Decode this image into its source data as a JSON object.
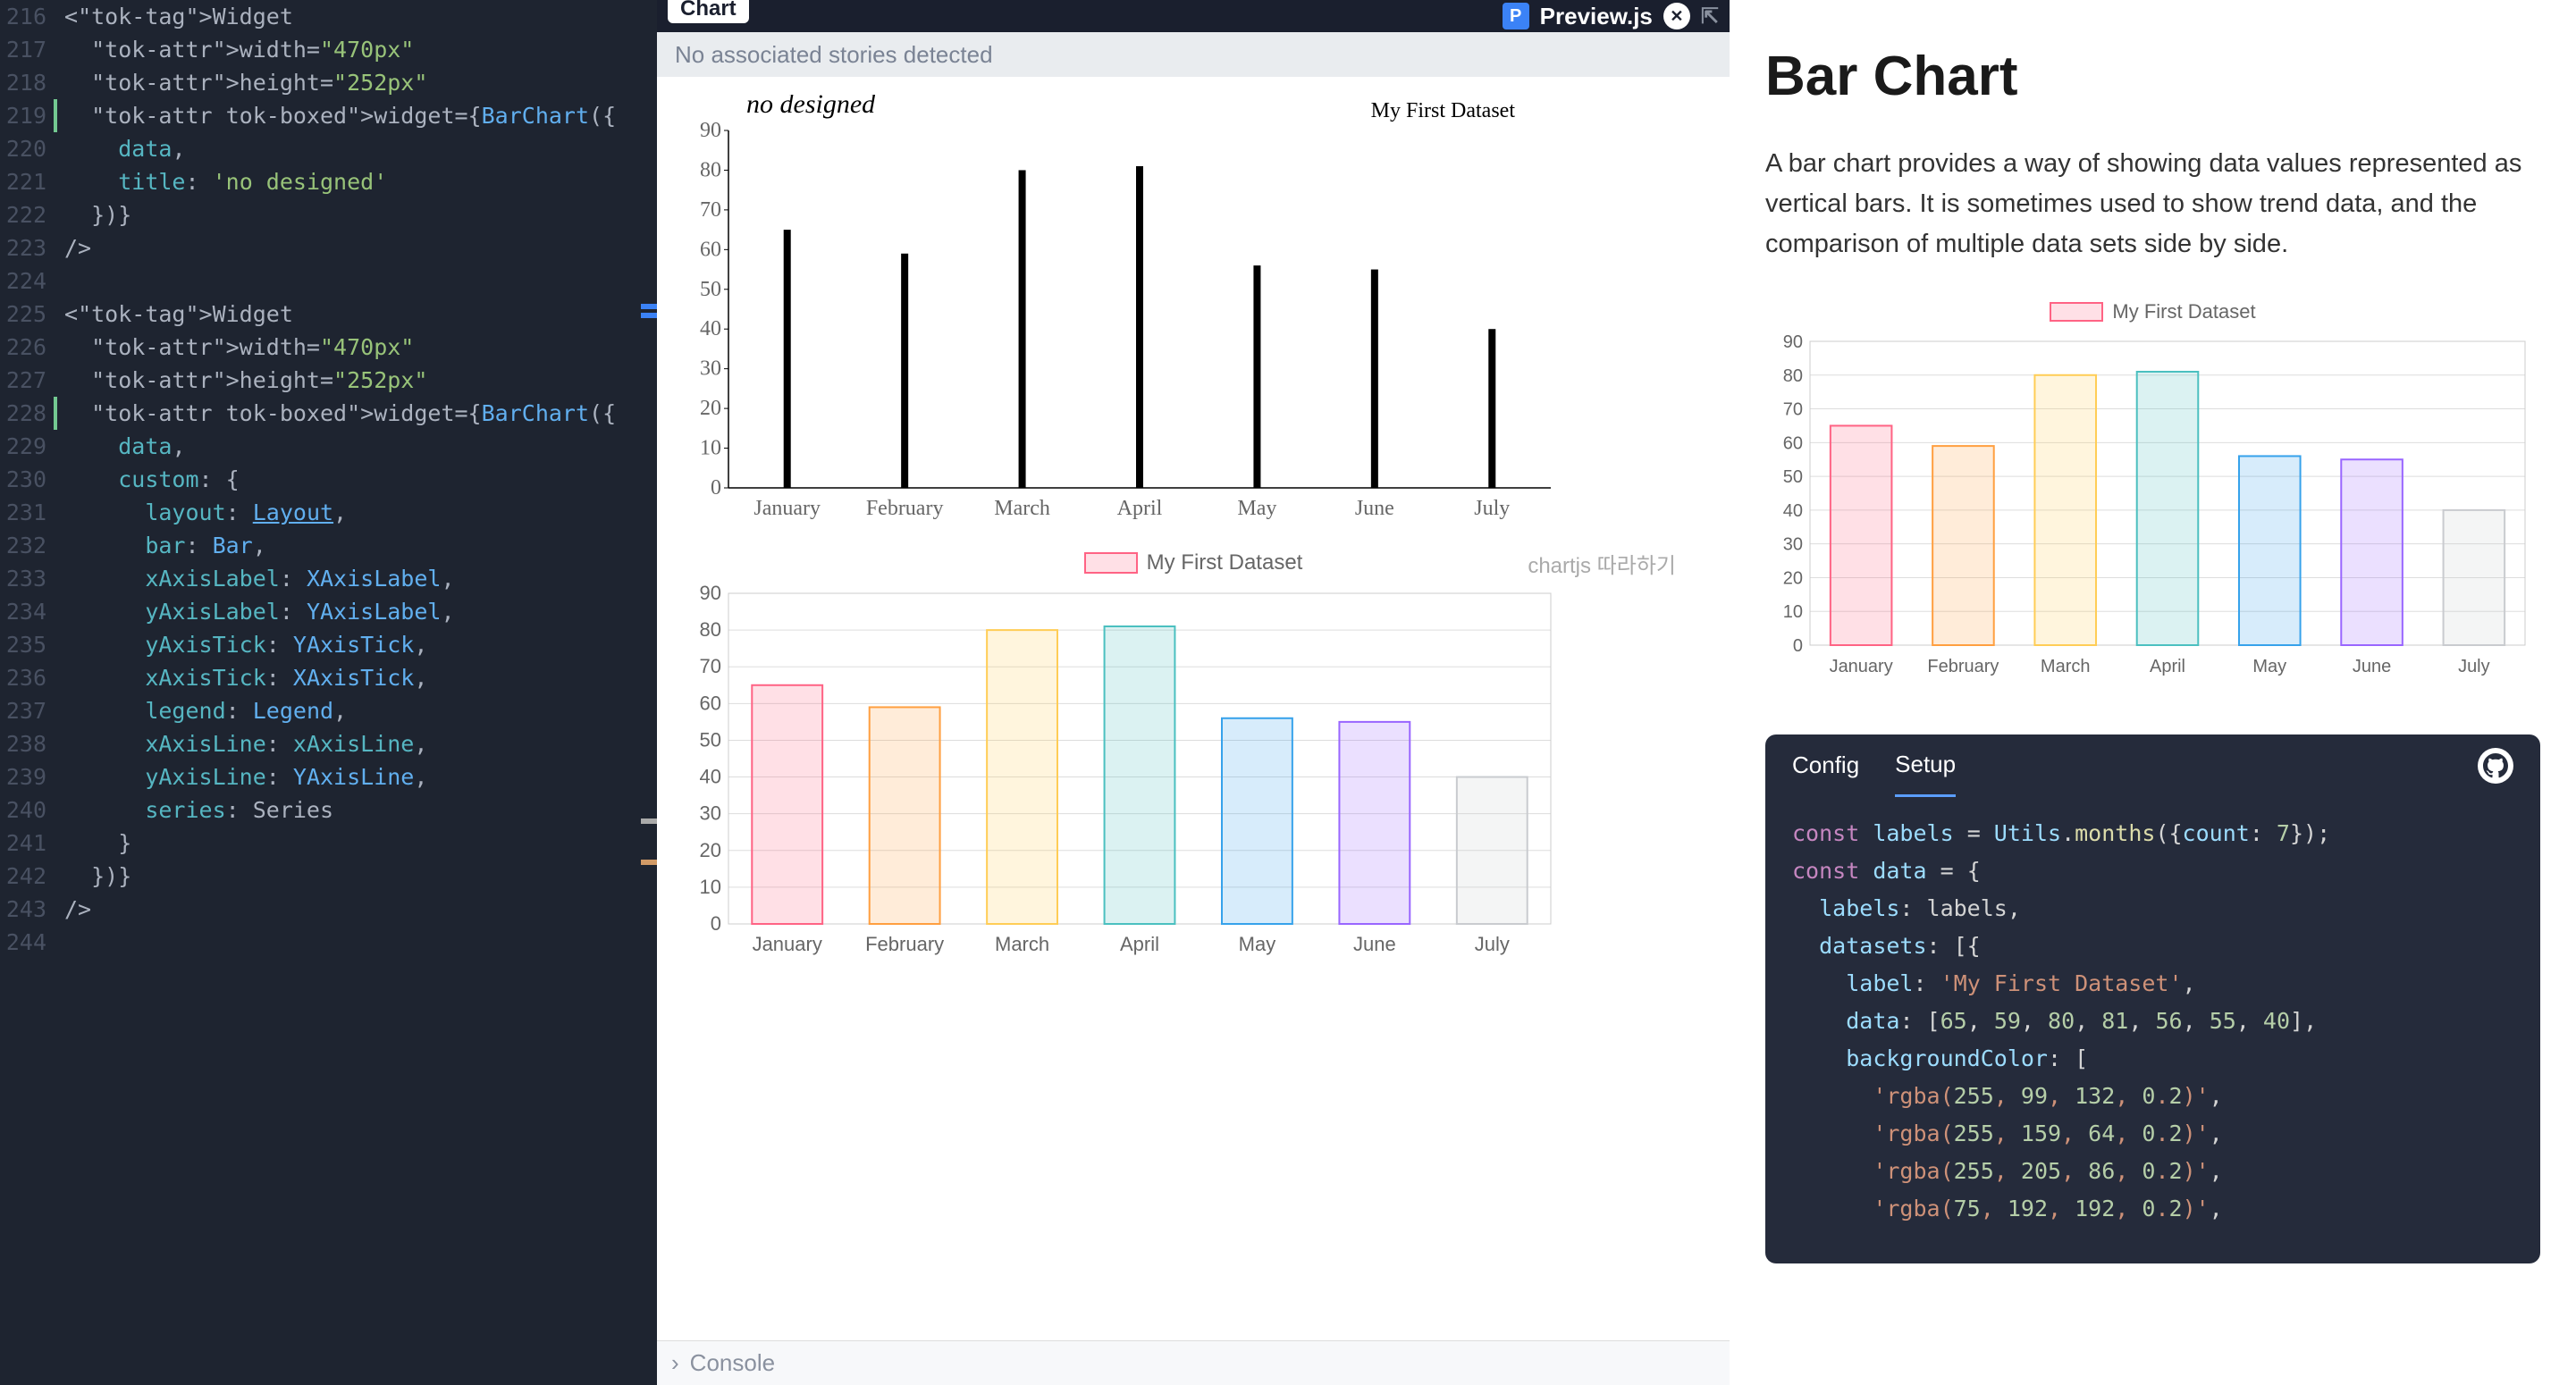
{
  "editor": {
    "startLine": 216,
    "lines": [
      {
        "n": 216,
        "t": "<Widget"
      },
      {
        "n": 217,
        "t": "  width=\"470px\""
      },
      {
        "n": 218,
        "t": "  height=\"252px\""
      },
      {
        "n": 219,
        "t": "  widget={BarChart({",
        "diff": true
      },
      {
        "n": 220,
        "t": "    data,"
      },
      {
        "n": 221,
        "t": "    title: 'no designed'"
      },
      {
        "n": 222,
        "t": "  })}"
      },
      {
        "n": 223,
        "t": "/>"
      },
      {
        "n": 224,
        "t": ""
      },
      {
        "n": 225,
        "t": "<Widget"
      },
      {
        "n": 226,
        "t": "  width=\"470px\""
      },
      {
        "n": 227,
        "t": "  height=\"252px\""
      },
      {
        "n": 228,
        "t": "  widget={BarChart({",
        "diff": true
      },
      {
        "n": 229,
        "t": "    data,"
      },
      {
        "n": 230,
        "t": "    custom: {"
      },
      {
        "n": 231,
        "t": "      layout: Layout,"
      },
      {
        "n": 232,
        "t": "      bar: Bar,"
      },
      {
        "n": 233,
        "t": "      xAxisLabel: XAxisLabel,"
      },
      {
        "n": 234,
        "t": "      yAxisLabel: YAxisLabel,"
      },
      {
        "n": 235,
        "t": "      yAxisTick: YAxisTick,"
      },
      {
        "n": 236,
        "t": "      xAxisTick: XAxisTick,"
      },
      {
        "n": 237,
        "t": "      legend: Legend,"
      },
      {
        "n": 238,
        "t": "      xAxisLine: xAxisLine,"
      },
      {
        "n": 239,
        "t": "      yAxisLine: YAxisLine,"
      },
      {
        "n": 240,
        "t": "      series: Series"
      },
      {
        "n": 241,
        "t": "    }"
      },
      {
        "n": 242,
        "t": "  })}"
      },
      {
        "n": 243,
        "t": "/>"
      },
      {
        "n": 244,
        "t": ""
      }
    ]
  },
  "preview": {
    "tab": "Chart",
    "brand": "Preview.js",
    "noStories": "No associated stories detected",
    "console": "Console",
    "chart1": {
      "title": "no designed",
      "legend": "My First Dataset"
    },
    "chart2": {
      "legend": "My First Dataset",
      "rightLabel": "chartjs 따라하기"
    }
  },
  "docs": {
    "title": "Bar Chart",
    "description": "A bar chart provides a way of showing data values represented as vertical bars. It is sometimes used to show trend data, and the comparison of multiple data sets side by side.",
    "legend": "My First Dataset",
    "tabs": {
      "config": "Config",
      "setup": "Setup"
    },
    "codeLines": [
      "const labels = Utils.months({count: 7});",
      "const data = {",
      "  labels: labels,",
      "  datasets: [{",
      "    label: 'My First Dataset',",
      "    data: [65, 59, 80, 81, 56, 55, 40],",
      "    backgroundColor: [",
      "      'rgba(255, 99, 132, 0.2)',",
      "      'rgba(255, 159, 64, 0.2)',",
      "      'rgba(255, 205, 86, 0.2)',",
      "      'rgba(75, 192, 192, 0.2)',"
    ]
  },
  "chart_data": {
    "type": "bar",
    "categories": [
      "January",
      "February",
      "March",
      "April",
      "May",
      "June",
      "July"
    ],
    "series": [
      {
        "name": "My First Dataset",
        "values": [
          65,
          59,
          80,
          81,
          56,
          55,
          40
        ]
      }
    ],
    "title": "no designed",
    "xlabel": "",
    "ylabel": "",
    "ylim": [
      0,
      90
    ],
    "yticks": [
      0,
      10,
      20,
      30,
      40,
      50,
      60,
      70,
      80,
      90
    ],
    "colors": {
      "fill": [
        "rgba(255,99,132,0.2)",
        "rgba(255,159,64,0.2)",
        "rgba(255,205,86,0.2)",
        "rgba(75,192,192,0.2)",
        "rgba(54,162,235,0.2)",
        "rgba(153,102,255,0.2)",
        "rgba(201,203,207,0.2)"
      ],
      "border": [
        "rgba(255,99,132,1)",
        "rgba(255,159,64,1)",
        "rgba(255,205,86,1)",
        "rgba(75,192,192,1)",
        "rgba(54,162,235,1)",
        "rgba(153,102,255,1)",
        "rgba(201,203,207,1)"
      ]
    }
  }
}
